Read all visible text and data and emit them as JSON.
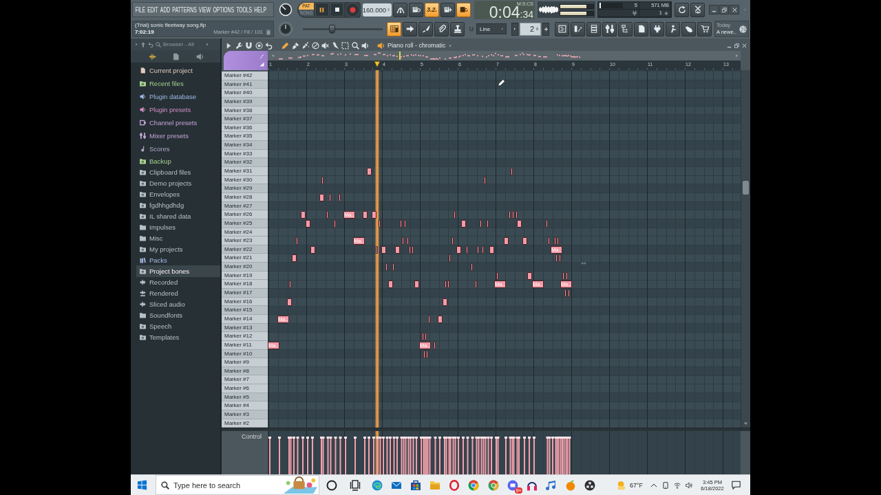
{
  "menu": [
    "FILE",
    "EDIT",
    "ADD",
    "PATTERNS",
    "VIEW",
    "OPTIONS",
    "TOOLS",
    "HELP"
  ],
  "project": {
    "title": "(Trial) sonic fleetway song.flp",
    "time": "7:02:19",
    "hint": "Marker #42 / F8 / 101"
  },
  "transport": {
    "modes": [
      {
        "label": "PAT",
        "selected": true
      },
      {
        "label": "SONG",
        "selected": false
      }
    ],
    "playing": true,
    "tempo": "160.000"
  },
  "toggles": [
    {
      "kind": "arch",
      "on": false
    },
    {
      "kind": "keys-clock",
      "on": false
    },
    {
      "kind": "countdown",
      "label": "3.2.",
      "on": true
    },
    {
      "kind": "keys-plus",
      "on": false
    },
    {
      "kind": "keys-loop",
      "on": true
    }
  ],
  "time": {
    "main": "0:04",
    "fraction": ":34",
    "unit": "M:S:CS"
  },
  "output_meter": [
    {
      "level": 0.79
    },
    {
      "level": 0.79
    }
  ],
  "cpu": {
    "level": 0.05,
    "reading": "5"
  },
  "memory": "571 MB",
  "polyphony": "1",
  "pitch_slider": {
    "level": 0.36
  },
  "tools": [
    {
      "kind": "keys-grid",
      "on": true
    },
    {
      "kind": "arrow",
      "on": false
    },
    {
      "kind": "brush",
      "on": false
    },
    {
      "kind": "paperclip",
      "on": false
    },
    {
      "kind": "stamp",
      "on": false
    }
  ],
  "snap": "Line",
  "pattern": "2",
  "news": {
    "date": "Today",
    "headline": "A newe.."
  },
  "browser": {
    "title": "Browser - All",
    "items": [
      {
        "label": "Current project",
        "kind": "project",
        "color": "#e2cabe",
        "selected": false
      },
      {
        "label": "Recent files",
        "kind": "sync-folder",
        "color": "#a8d28e",
        "selected": false
      },
      {
        "label": "Plugin database",
        "kind": "plugin",
        "color": "#9fb9e4",
        "selected": false
      },
      {
        "label": "Plugin presets",
        "kind": "plugin",
        "color": "#d690c6",
        "selected": false
      },
      {
        "label": "Channel presets",
        "kind": "channel",
        "color": "#c6a2d8",
        "selected": false
      },
      {
        "label": "Mixer presets",
        "kind": "mixer",
        "color": "#c6a2d8",
        "selected": false
      },
      {
        "label": "Scores",
        "kind": "score",
        "color": "#b4a8c6",
        "selected": false
      },
      {
        "label": "Backup",
        "kind": "sync-folder",
        "color": "#a8d28e",
        "selected": false
      },
      {
        "label": "Clipboard files",
        "kind": "sync-folder",
        "color": "#b3c0c8",
        "selected": false
      },
      {
        "label": "Demo projects",
        "kind": "sync-folder",
        "color": "#b3c0c8",
        "selected": false
      },
      {
        "label": "Envelopes",
        "kind": "sync-folder",
        "color": "#b3c0c8",
        "selected": false
      },
      {
        "label": "fgdhhgdhdg",
        "kind": "sync-folder",
        "color": "#b3c0c8",
        "selected": false
      },
      {
        "label": "IL shared data",
        "kind": "sync-folder",
        "color": "#b3c0c8",
        "selected": false
      },
      {
        "label": "Impulses",
        "kind": "folder",
        "color": "#b3c0c8",
        "selected": false
      },
      {
        "label": "Misc",
        "kind": "folder",
        "color": "#b3c0c8",
        "selected": false
      },
      {
        "label": "My projects",
        "kind": "sync-folder",
        "color": "#b3c0c8",
        "selected": false
      },
      {
        "label": "Packs",
        "kind": "packs",
        "color": "#a8bce6",
        "selected": false
      },
      {
        "label": "Project bones",
        "kind": "sync-folder",
        "color": "#b3c0c8",
        "selected": true
      },
      {
        "label": "Recorded",
        "kind": "audio",
        "color": "#b3c0c8",
        "selected": false
      },
      {
        "label": "Rendered",
        "kind": "rendered",
        "color": "#b3c0c8",
        "selected": false
      },
      {
        "label": "Sliced audio",
        "kind": "audio",
        "color": "#b3c0c8",
        "selected": false
      },
      {
        "label": "Soundfonts",
        "kind": "folder",
        "color": "#b3c0c8",
        "selected": false
      },
      {
        "label": "Speech",
        "kind": "sync-folder",
        "color": "#b3c0c8",
        "selected": false
      },
      {
        "label": "Templates",
        "kind": "sync-folder",
        "color": "#b3c0c8",
        "selected": false
      }
    ]
  },
  "piano_roll": {
    "title": "Piano roll - chromatic",
    "tools": [
      {
        "kind": "pencil",
        "selected": true
      },
      {
        "kind": "brush",
        "selected": false
      },
      {
        "kind": "brush-dots",
        "selected": false
      },
      {
        "kind": "no-entry",
        "selected": false
      },
      {
        "kind": "mute",
        "selected": false
      },
      {
        "kind": "knife",
        "selected": false
      },
      {
        "kind": "dashed-square",
        "selected": false
      },
      {
        "kind": "magnifier",
        "selected": false
      },
      {
        "kind": "speaker",
        "selected": false
      }
    ],
    "bars": [
      "1",
      "2",
      "3",
      "4",
      "5",
      "6",
      "7",
      "8",
      "9",
      "10",
      "11",
      "12",
      "13"
    ],
    "keys": [
      "Marker #42",
      "Marker #41",
      "Marker #40",
      "Marker #39",
      "Marker #38",
      "Marker #37",
      "Marker #36",
      "Marker #35",
      "Marker #34",
      "Marker #33",
      "Marker #32",
      "Marker #31",
      "Marker #30",
      "Marker #29",
      "Marker #28",
      "Marker #27",
      "Marker #26",
      "Marker #25",
      "Marker #24",
      "Marker #23",
      "Marker #22",
      "Marker #21",
      "Marker #20",
      "Marker #19",
      "Marker #18",
      "Marker #17",
      "Marker #16",
      "Marker #15",
      "Marker #14",
      "Marker #13",
      "Marker #12",
      "Marker #11",
      "Marker #10",
      "Marker #9",
      "Marker #8",
      "Marker #7",
      "Marker #6",
      "Marker #5",
      "Marker #4",
      "Marker #3",
      "Marker #2"
    ],
    "note_labels": [
      "Ma..",
      "Ma..",
      "Ma..",
      "Ma..",
      "Ma..",
      "Ma..",
      "Ma..",
      "Ma..",
      "Ma.."
    ],
    "lane": "Control"
  },
  "taskbar": {
    "search_placeholder": "Type here to search",
    "badge": "9+",
    "weather": "67°F",
    "time": "3:45 PM",
    "date": "6/18/2022"
  }
}
